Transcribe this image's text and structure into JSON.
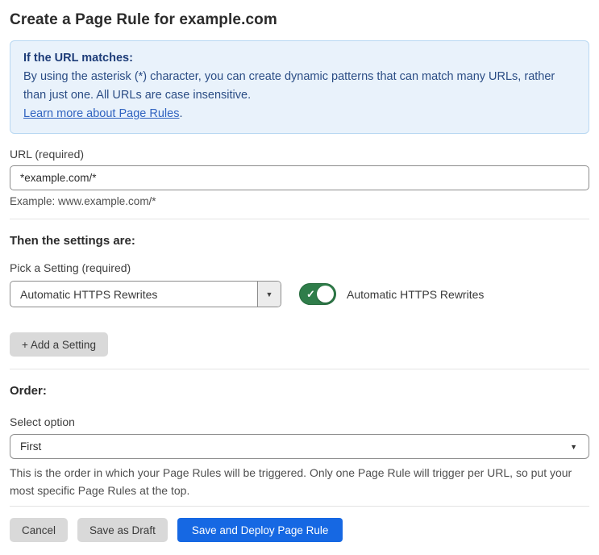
{
  "page": {
    "title": "Create a Page Rule for example.com"
  },
  "info_box": {
    "heading": "If the URL matches:",
    "body": "By using the asterisk (*) character, you can create dynamic patterns that can match many URLs, rather than just one. All URLs are case insensitive.",
    "link": "Learn more about Page Rules",
    "link_suffix": "."
  },
  "url_field": {
    "label": "URL (required)",
    "value": "*example.com/*",
    "helper": "Example: www.example.com/*"
  },
  "settings_section": {
    "heading": "Then the settings are:",
    "picker_label": "Pick a Setting (required)",
    "picker_value": "Automatic HTTPS Rewrites",
    "toggle_state": "on",
    "toggle_label": "Automatic HTTPS Rewrites",
    "add_button": "+ Add a Setting"
  },
  "order_section": {
    "heading": "Order:",
    "select_label": "Select option",
    "select_value": "First",
    "helper": "This is the order in which your Page Rules will be triggered. Only one Page Rule will trigger per URL, so put your most specific Page Rules at the top."
  },
  "footer": {
    "cancel": "Cancel",
    "save_draft": "Save as Draft",
    "save_deploy": "Save and Deploy Page Rule"
  },
  "icons": {
    "dropdown_arrow": "▼",
    "check": "✓"
  },
  "colors": {
    "accent_blue": "#1668e3",
    "info_bg": "#e9f2fb",
    "info_border": "#b9d8f2",
    "info_heading": "#1d3c78",
    "info_text": "#2b4d85",
    "link_blue": "#3063c0",
    "toggle_green": "#2f7d4a",
    "btn_gray": "#d9d9d9",
    "border_gray": "#8d8d8d"
  }
}
